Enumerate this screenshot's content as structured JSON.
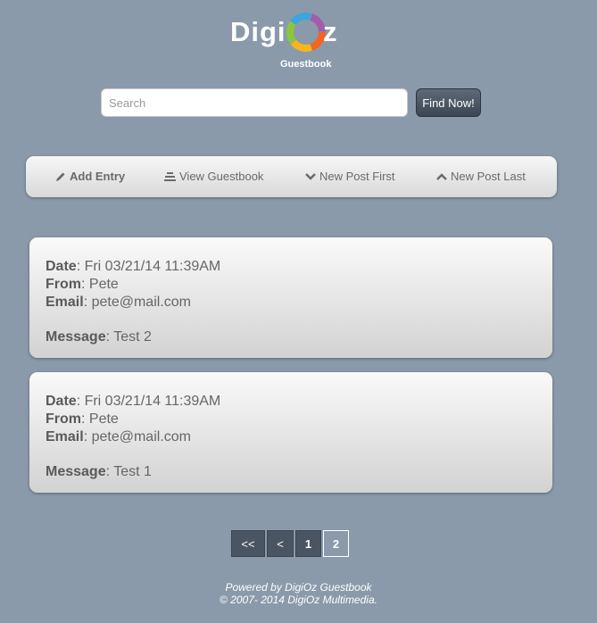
{
  "brand": {
    "name_left": "Digi",
    "name_right": "z",
    "subtitle": "Guestbook",
    "ring_colors": [
      "#f26522",
      "#f7b61b",
      "#8cc63f",
      "#3aa6dd",
      "#a25ea8"
    ]
  },
  "search": {
    "placeholder": "Search",
    "value": "",
    "button_label": "Find Now!"
  },
  "nav": {
    "items": [
      {
        "label": "Add Entry",
        "icon": "pencil-icon"
      },
      {
        "label": "View Guestbook",
        "icon": "list-icon"
      },
      {
        "label": "New Post First",
        "icon": "chevron-down-icon"
      },
      {
        "label": "New Post Last",
        "icon": "chevron-up-icon"
      }
    ]
  },
  "entries": [
    {
      "date_label": "Date",
      "date": "Fri 03/21/14 11:39AM",
      "from_label": "From",
      "from": "Pete",
      "email_label": "Email",
      "email": "pete@mail.com",
      "message_label": "Message",
      "message": "Test 2"
    },
    {
      "date_label": "Date",
      "date": "Fri 03/21/14 11:39AM",
      "from_label": "From",
      "from": "Pete",
      "email_label": "Email",
      "email": "pete@mail.com",
      "message_label": "Message",
      "message": "Test 1"
    }
  ],
  "pagination": {
    "first": "<<",
    "prev": "<",
    "pages": [
      "1",
      "2"
    ],
    "current_page": "1"
  },
  "footer": {
    "line1": "Powered by DigiOz Guestbook",
    "line2": "© 2007- 2014 DigiOz Multimedia."
  }
}
